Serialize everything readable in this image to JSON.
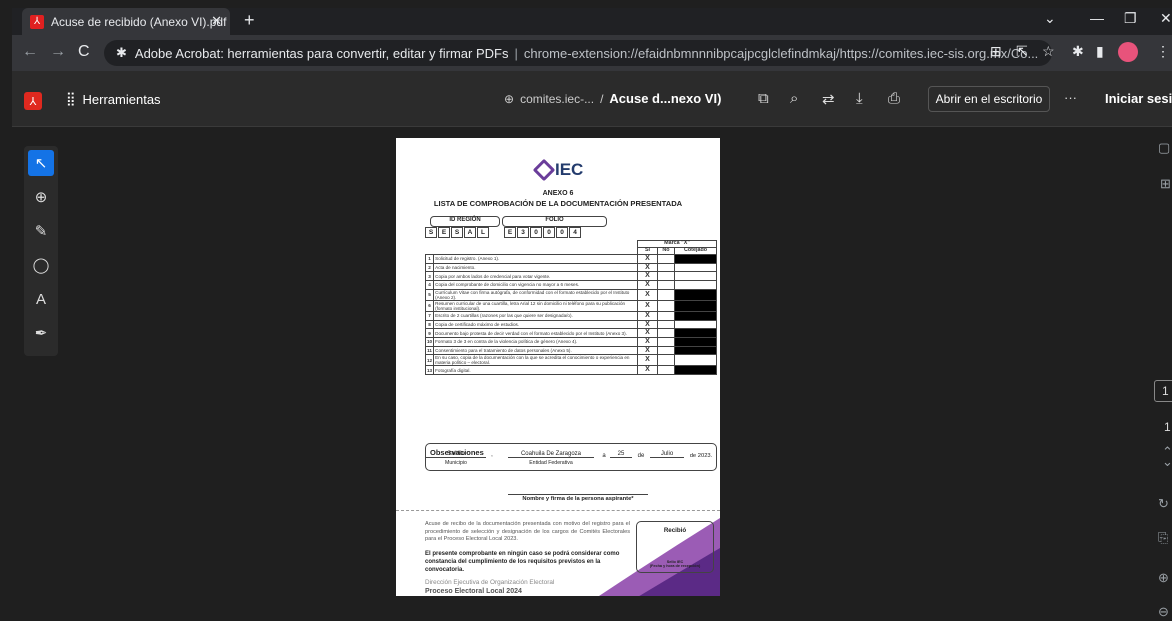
{
  "browser": {
    "tab_title": "Acuse de recibido (Anexo VI).pdf",
    "omnibox_title": "Adobe Acrobat: herramientas para convertir, editar y firmar PDFs",
    "omnibox_url": "chrome-extension://efaidnbmnnnibpcajpcglclefindmkaj/https://comites.iec-sis.org.mx/Co..."
  },
  "acrobat": {
    "tools_label": "Herramientas",
    "domain": "comites.iec-...",
    "file_name": "Acuse d...nexo VI)",
    "open_desktop": "Abrir en el escritorio",
    "more": "···",
    "sign_in": "Iniciar sesión",
    "page_number": "1",
    "page_total": "1"
  },
  "document": {
    "logo": "IEC",
    "annex": "ANEXO 6",
    "title": "LISTA DE COMPROBACIÓN DE LA DOCUMENTACIÓN PRESENTADA",
    "region_label": "ID REGIÓN",
    "region_chars": [
      "S",
      "E",
      "S",
      "A",
      "L"
    ],
    "folio_label": "FOLIO",
    "folio_chars": [
      "E",
      "3",
      "0",
      "0",
      "0",
      "4"
    ],
    "marca_label": "Marca \"X\"",
    "col_si": "Sí",
    "col_no": "No",
    "col_cotejado": "Cotejado",
    "items": [
      {
        "n": "1",
        "text": "Solicitud de registro. (Anexo 1).",
        "si": "X",
        "blk": true
      },
      {
        "n": "2",
        "text": "Acta de nacimiento.",
        "si": "X",
        "blk": false
      },
      {
        "n": "3",
        "text": "Copia por ambos lados de credencial para votar vigente.",
        "si": "X",
        "blk": false
      },
      {
        "n": "4",
        "text": "Copia del comprobante de domicilio con vigencia no mayor a 6 meses.",
        "si": "X",
        "blk": false
      },
      {
        "n": "5",
        "text": "Currículum Vitae con firma autógrafa, de conformidad con el formato establecido por el Instituto (Anexo 2).",
        "si": "X",
        "blk": true
      },
      {
        "n": "6",
        "text": "Resumen curricular de una cuartilla, letra Arial 12 sin domicilio ni teléfono para su publicación (formato institucional).",
        "si": "X",
        "blk": true
      },
      {
        "n": "7",
        "text": "Escrito de 2 cuartillas (razones por las que quiere ser designada/o).",
        "si": "X",
        "blk": true
      },
      {
        "n": "8",
        "text": "Copia de certificado máximo de estudios.",
        "si": "X",
        "blk": false
      },
      {
        "n": "9",
        "text": "Documento bajo protesta de decir verdad con el formato establecido por el Instituto (Anexo 3).",
        "si": "X",
        "blk": true
      },
      {
        "n": "10",
        "text": "Formato 3 de 3 en contra de la violencia política de género (Anexo 4).",
        "si": "X",
        "blk": true
      },
      {
        "n": "11",
        "text": "Consentimiento para el tratamiento de datos personales (Anexo 5).",
        "si": "X",
        "blk": true
      },
      {
        "n": "12",
        "text": "En su caso, copia de la documentación con la que se acredita el conocimiento o experiencia en materia político – electoral.",
        "si": "X",
        "blk": false
      },
      {
        "n": "13",
        "text": "Fotografía digital.",
        "si": "X",
        "blk": true
      }
    ],
    "observations": "Observaciones",
    "city": "Saltillo",
    "state": "Coahuila De Zaragoza",
    "day": "25",
    "month": "Julio",
    "year_text": "de 2023.",
    "a": "a",
    "de": "de",
    "comma": ",",
    "municipio": "Municipio",
    "entidad": "Entidad Federativa",
    "signature_label": "Nombre y firma de la persona aspirante*",
    "receipt_text": "Acuse de recibo de la documentación presentada con motivo del registro para el procedimiento de selección y designación de los cargos de Comités Electorales para el Proceso Electoral Local 2023.",
    "note": "El presente comprobante en ningún caso se podrá considerar como constancia del cumplimiento de los requisitos previstos en la convocatoria.",
    "received": "Recibió",
    "stamp": "Sello IEC",
    "stamp_sub": "(Fecha y hora de recepción)",
    "direction": "Dirección Ejecutiva de Organización Electoral",
    "process": "Proceso Electoral Local 2024"
  }
}
